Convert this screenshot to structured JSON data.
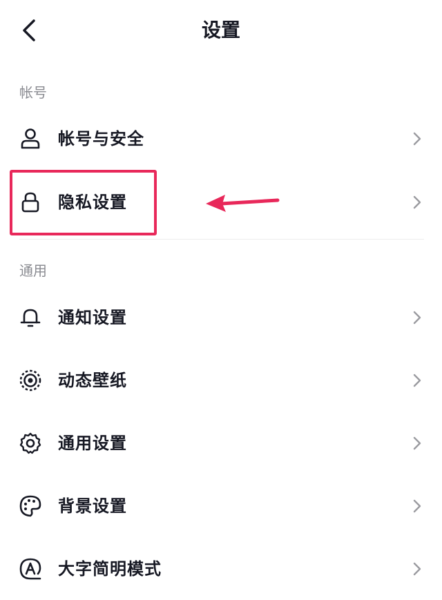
{
  "header": {
    "title": "设置",
    "back_icon": "chevron-left-icon"
  },
  "sections": [
    {
      "title": "帐号",
      "items": [
        {
          "label": "帐号与安全",
          "icon": "user-icon"
        },
        {
          "label": "隐私设置",
          "icon": "lock-icon"
        }
      ]
    },
    {
      "title": "通用",
      "items": [
        {
          "label": "通知设置",
          "icon": "bell-icon"
        },
        {
          "label": "动态壁纸",
          "icon": "wallpaper-icon"
        },
        {
          "label": "通用设置",
          "icon": "gear-icon"
        },
        {
          "label": "背景设置",
          "icon": "palette-icon"
        },
        {
          "label": "大字简明模式",
          "icon": "font-size-icon"
        }
      ]
    }
  ],
  "colors": {
    "text_primary": "#161823",
    "text_secondary": "#8a8b91",
    "annotation": "#e8285a",
    "chevron": "#9a9ba0"
  }
}
